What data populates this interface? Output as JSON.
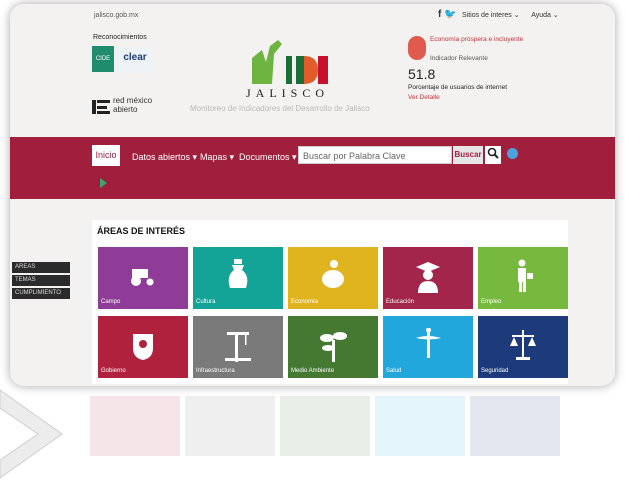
{
  "top": {
    "site": "jalisco.gob.mx",
    "social_icons": "f 🐦",
    "links": [
      "Sitios de interes ⌄",
      "Ayuda ⌄"
    ]
  },
  "header": {
    "reconocimientos": "Reconocimientos",
    "cide": "CIDE",
    "clear": "clear",
    "red_mexico": "red méxico\nabierto",
    "logo": "MIDE",
    "jalisco": "JALISCO",
    "subtitle": "Monitoreo de Indicadores del Desarrollo de Jalisco"
  },
  "indicator": {
    "title": "Economía próspera e incluyente",
    "subtitle": "Indicador Relevante",
    "value": "51.8",
    "description": "Porcentaje de usuarios de internet",
    "link": "Ver Detalle"
  },
  "nav": {
    "inicio": "Inicio",
    "datos": "Datos abiertos ▾",
    "mapas": "Mapas ▾",
    "documentos": "Documentos ▾",
    "search_placeholder": "Buscar por Palabra Clave",
    "search_button": "Buscar"
  },
  "areas": {
    "title": "ÁREAS DE INTERÉS",
    "tiles": [
      {
        "label": "Campo",
        "color": "#8e3c97"
      },
      {
        "label": "Cultura",
        "color": "#14a397"
      },
      {
        "label": "Economía",
        "color": "#e0b41f"
      },
      {
        "label": "Educación",
        "color": "#a3254b"
      },
      {
        "label": "Empleo",
        "color": "#77b83f"
      },
      {
        "label": "Gobierno",
        "color": "#b0213e"
      },
      {
        "label": "Infraestructura",
        "color": "#7a7a7a"
      },
      {
        "label": "Medio Ambiente",
        "color": "#457932"
      },
      {
        "label": "Salud",
        "color": "#22a7dc"
      },
      {
        "label": "Seguridad",
        "color": "#1d3b7a"
      }
    ]
  },
  "side_menu": [
    "AREAS",
    "TEMAS",
    "CUMPLIMIENTO"
  ]
}
